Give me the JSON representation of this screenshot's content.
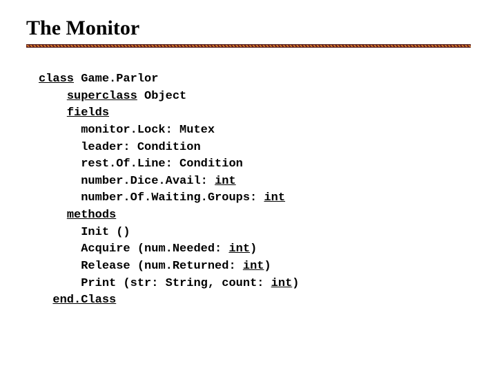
{
  "title": "The Monitor",
  "code": {
    "kw_class": "class",
    "class_name": "Game.Parlor",
    "kw_superclass": "superclass",
    "superclass_name": "Object",
    "kw_fields": "fields",
    "f1_name": "monitor.Lock:",
    "f1_type": "Mutex",
    "f2_name": "leader:",
    "f2_type": "Condition",
    "f3_name": "rest.Of.Line:",
    "f3_type": "Condition",
    "f4_name": "number.Dice.Avail:",
    "kw_int": "int",
    "f5_name": "number.Of.Waiting.Groups:",
    "kw_methods": "methods",
    "m1": "Init ()",
    "m2_name": "Acquire",
    "m2_open": " (num.Needed: ",
    "m2_close": ")",
    "m3_name": "Release",
    "m3_open": " (num.Returned: ",
    "m3_close": ")",
    "m4_name": "Print",
    "m4_open": " (str: String, count: ",
    "m4_close": ")",
    "kw_endclass": "end.Class"
  }
}
